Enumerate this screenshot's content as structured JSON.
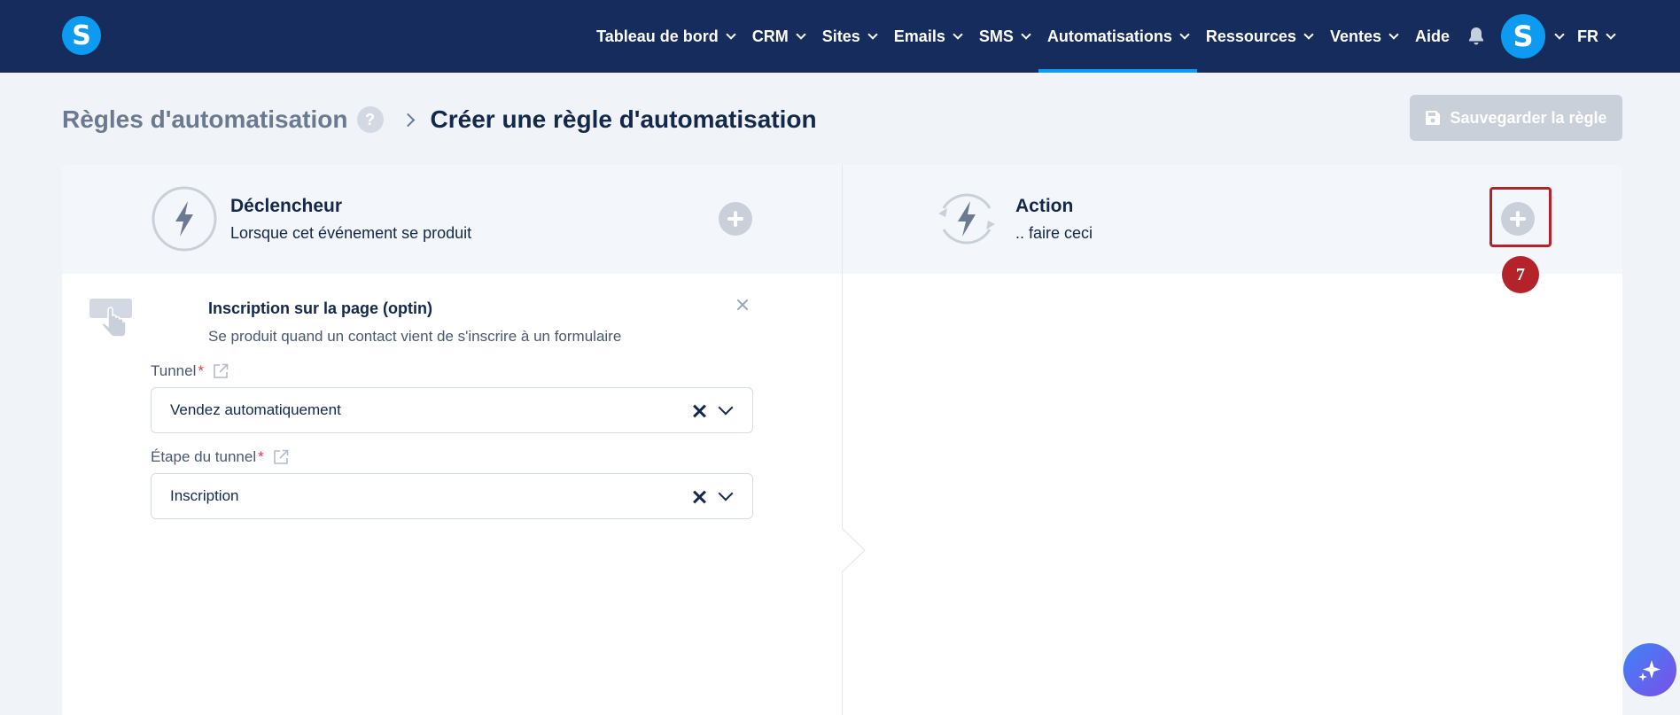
{
  "brand": {
    "logo_letter": "S",
    "accent": "#0d9bf2",
    "nav_bg": "#162c5c"
  },
  "nav": {
    "items": [
      {
        "label": "Tableau de bord",
        "has_dropdown": true
      },
      {
        "label": "CRM",
        "has_dropdown": true
      },
      {
        "label": "Sites",
        "has_dropdown": true
      },
      {
        "label": "Emails",
        "has_dropdown": true
      },
      {
        "label": "SMS",
        "has_dropdown": true
      },
      {
        "label": "Automatisations",
        "has_dropdown": true,
        "active": true
      },
      {
        "label": "Ressources",
        "has_dropdown": true
      },
      {
        "label": "Ventes",
        "has_dropdown": true
      },
      {
        "label": "Aide",
        "has_dropdown": false
      }
    ],
    "bell_icon": "bell-icon",
    "avatar_letter": "S",
    "language": "FR"
  },
  "header": {
    "breadcrumb_parent": "Règles d'automatisation",
    "help_label": "?",
    "breadcrumb_current": "Créer une règle d'automatisation",
    "save_label": "Sauvegarder la règle"
  },
  "trigger": {
    "title": "Déclencheur",
    "subtitle": "Lorsque cet événement se produit",
    "selected": {
      "title": "Inscription sur la page (optin)",
      "description": "Se produit quand un contact vient de s'inscrire à un formulaire"
    },
    "fields": [
      {
        "label": "Tunnel",
        "required_mark": "*",
        "value": "Vendez automatiquement"
      },
      {
        "label": "Étape du tunnel",
        "required_mark": "*",
        "value": "Inscription"
      }
    ]
  },
  "action": {
    "title": "Action",
    "subtitle": ".. faire ceci"
  },
  "annotation": {
    "step_number": "7",
    "color": "#b5232a"
  }
}
